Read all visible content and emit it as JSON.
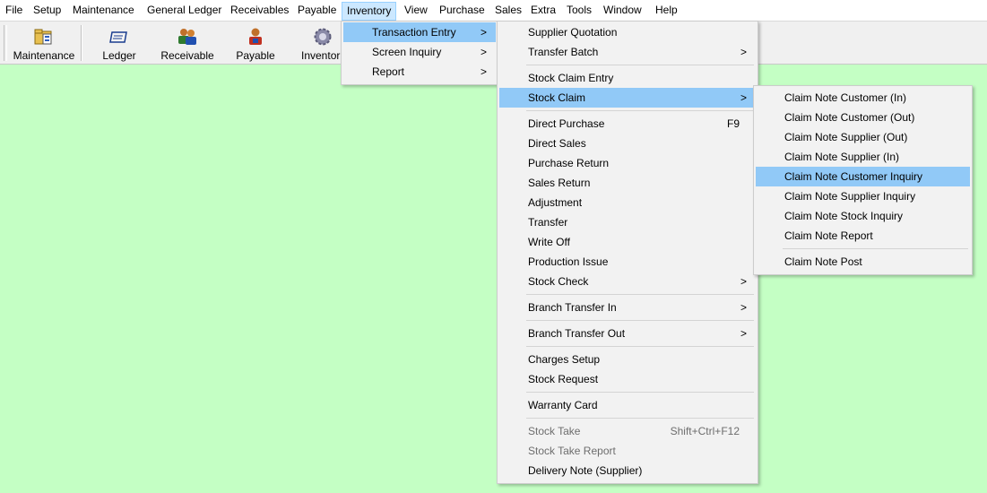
{
  "menubar": {
    "items": [
      "File",
      "Setup",
      "Maintenance",
      "General Ledger",
      "Receivables",
      "Payable",
      "Inventory",
      "View",
      "Purchase",
      "Sales",
      "Extra",
      "Tools",
      "Window",
      "Help"
    ]
  },
  "toolbar": {
    "buttons": [
      {
        "label": "Maintenance",
        "icon": "maintenance-folder-icon"
      },
      {
        "label": "Ledger",
        "icon": "ledger-book-icon"
      },
      {
        "label": "Receivable",
        "icon": "receivable-people-icon"
      },
      {
        "label": "Payable",
        "icon": "payable-person-icon"
      },
      {
        "label": "Inventor",
        "icon": "inventory-gear-icon"
      }
    ]
  },
  "inventory_menu": {
    "items": [
      {
        "label": "Transaction Entry",
        "submenu": true,
        "highlighted": true
      },
      {
        "label": "Screen Inquiry",
        "submenu": true
      },
      {
        "label": "Report",
        "submenu": true
      }
    ]
  },
  "transaction_menu": {
    "items": [
      {
        "label": "Supplier Quotation"
      },
      {
        "label": "Transfer Batch",
        "submenu": true
      },
      {
        "label": "Stock Claim Entry"
      },
      {
        "label": "Stock Claim",
        "submenu": true,
        "highlighted": true
      },
      {
        "label": "Direct Purchase",
        "shortcut": "F9"
      },
      {
        "label": "Direct Sales"
      },
      {
        "label": "Purchase Return"
      },
      {
        "label": "Sales Return"
      },
      {
        "label": "Adjustment"
      },
      {
        "label": "Transfer"
      },
      {
        "label": "Write Off"
      },
      {
        "label": "Production Issue"
      },
      {
        "label": "Stock Check",
        "submenu": true
      },
      {
        "label": "Branch Transfer In",
        "submenu": true
      },
      {
        "label": "Branch Transfer Out",
        "submenu": true
      },
      {
        "label": "Charges Setup"
      },
      {
        "label": "Stock Request"
      },
      {
        "label": "Warranty Card"
      },
      {
        "label": "Stock Take",
        "shortcut": "Shift+Ctrl+F12",
        "disabled": true
      },
      {
        "label": "Stock Take Report",
        "disabled": true
      },
      {
        "label": "Delivery Note (Supplier)"
      }
    ]
  },
  "stock_claim_menu": {
    "items": [
      {
        "label": "Claim Note Customer (In)"
      },
      {
        "label": "Claim Note Customer (Out)"
      },
      {
        "label": "Claim Note Supplier (Out)"
      },
      {
        "label": "Claim Note Supplier (In)"
      },
      {
        "label": "Claim Note Customer Inquiry",
        "highlighted": true
      },
      {
        "label": "Claim Note Supplier Inquiry"
      },
      {
        "label": "Claim Note Stock Inquiry"
      },
      {
        "label": "Claim Note Report"
      },
      {
        "label": "Claim Note Post"
      }
    ]
  },
  "submenu_arrow": ">",
  "colors": {
    "desktop": "#c4ffc4",
    "highlight": "#91c9f7",
    "active_menu": "#cce8ff"
  }
}
